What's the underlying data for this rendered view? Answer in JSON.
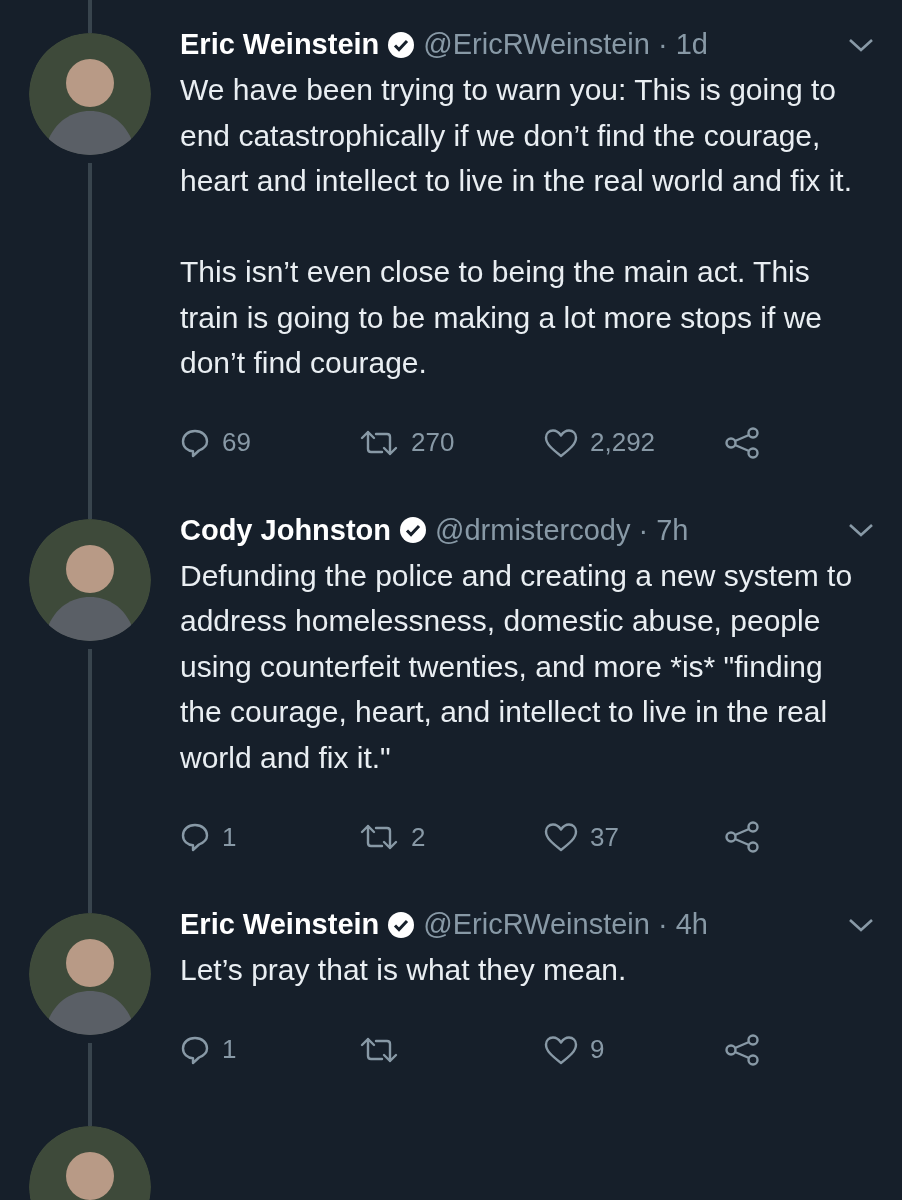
{
  "tweets": [
    {
      "name": "Eric Weinstein",
      "verified": true,
      "meta": "@EricRWeinstein · 1d",
      "paragraphs": [
        "We have been trying to warn you: This is going to end catastrophically if we don’t find the courage, heart and intellect to live in the real world and fix it.",
        "This isn’t even close to being the main act. This train is going to be making a lot more stops if we don’t find courage."
      ],
      "replies": "69",
      "retweets": "270",
      "likes": "2,292"
    },
    {
      "name": "Cody Johnston",
      "verified": true,
      "meta": "@drmistercody · 7h",
      "paragraphs": [
        "Defunding the police and creating a new system to address homelessness, domestic abuse, people using counterfeit twenties, and more *is* \"finding the courage, heart, and intellect to live in the real world and fix it.\""
      ],
      "replies": "1",
      "retweets": "2",
      "likes": "37"
    },
    {
      "name": "Eric Weinstein",
      "verified": true,
      "meta": "@EricRWeinstein · 4h",
      "paragraphs": [
        "Let’s pray that is what they mean."
      ],
      "replies": "1",
      "likes": "9"
    }
  ]
}
